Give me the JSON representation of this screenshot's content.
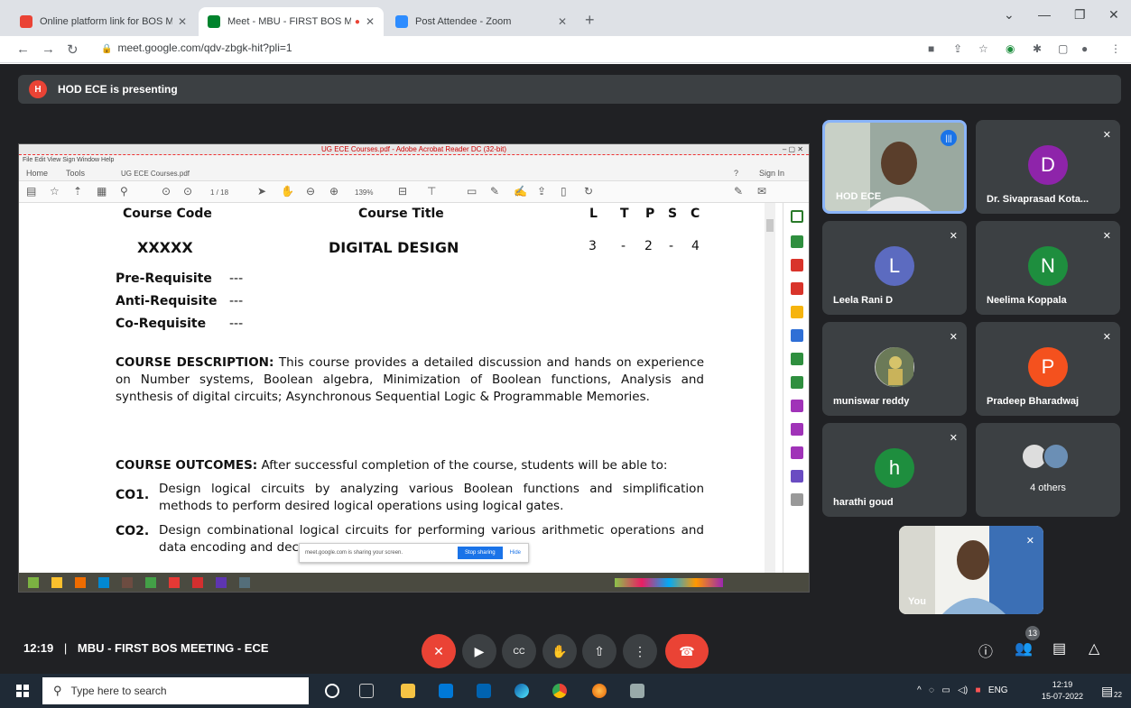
{
  "browser": {
    "tabs": [
      {
        "label": "Online platform link for BOS Me",
        "favicon_color": "#ea4335"
      },
      {
        "label": "Meet - MBU - FIRST BOS M",
        "favicon_color": "#00832d"
      },
      {
        "label": "Post Attendee - Zoom",
        "favicon_color": "#2d8cff"
      }
    ],
    "url": "meet.google.com/qdv-zbgk-hit?pli=1"
  },
  "banner": {
    "initial": "H",
    "text": "HOD ECE is presenting"
  },
  "acrobat": {
    "title": "UG ECE Courses.pdf - Adobe Acrobat Reader DC (32-bit)",
    "menu": "File  Edit  View  Sign  Window  Help",
    "tabs": {
      "home": "Home",
      "tools": "Tools",
      "doc": "UG ECE Courses.pdf",
      "sign_in": "Sign In"
    },
    "page": "1 / 18",
    "zoom": "139%"
  },
  "doc": {
    "hdr_code": "Course Code",
    "hdr_title": "Course Title",
    "hdr_ltpsc": [
      "L",
      "T",
      "P",
      "S",
      "C"
    ],
    "code": "XXXXX",
    "title": "DIGITAL DESIGN",
    "ltpsc": [
      "3",
      "-",
      "2",
      "-",
      "4"
    ],
    "pre_label": "Pre-Requisite",
    "pre_val": "---",
    "anti_label": "Anti-Requisite",
    "anti_val": "---",
    "co_label": "Co-Requisite",
    "co_val": "---",
    "desc_label": "COURSE DESCRIPTION:",
    "desc_text": "This course provides a detailed discussion and hands on experience on Number systems, Boolean algebra, Minimization of Boolean functions, Analysis and synthesis of digital circuits; Asynchronous Sequential Logic & Programmable Memories.",
    "outcomes_label": "COURSE OUTCOMES:",
    "outcomes_text": "After successful completion of the course, students will be able to:",
    "co1_id": "CO1.",
    "co1_text": "Design logical circuits by analyzing various Boolean functions and simplification methods to perform desired logical operations using logical gates.",
    "co2_id": "CO2.",
    "co2_text": "Design combinational logical circuits for performing various arithmetic operations and data encoding and dec"
  },
  "share_notice": {
    "text": "meet.google.com is sharing your screen.",
    "stop": "Stop sharing",
    "hide": "Hide"
  },
  "participants": [
    {
      "name": "HOD ECE"
    },
    {
      "name": "Dr. Sivaprasad Kota...",
      "initial": "D",
      "color": "#8e24aa"
    },
    {
      "name": "Leela Rani D",
      "initial": "L",
      "color": "#5c6bc0"
    },
    {
      "name": "Neelima Koppala",
      "initial": "N",
      "color": "#1e8e3e"
    },
    {
      "name": "muniswar reddy"
    },
    {
      "name": "Pradeep Bharadwaj",
      "initial": "P",
      "color": "#f4511e"
    },
    {
      "name": "harathi goud",
      "initial": "h",
      "color": "#1e8e3e"
    },
    {
      "name": "4 others"
    },
    {
      "name": "You"
    }
  ],
  "meeting": {
    "time": "12:19",
    "sep": "|",
    "name": "MBU - FIRST BOS MEETING - ECE",
    "people_count": "13"
  },
  "taskbar": {
    "search_placeholder": "Type here to search",
    "lang": "ENG",
    "time": "12:19",
    "date": "15-07-2022",
    "notif_count": "22"
  }
}
